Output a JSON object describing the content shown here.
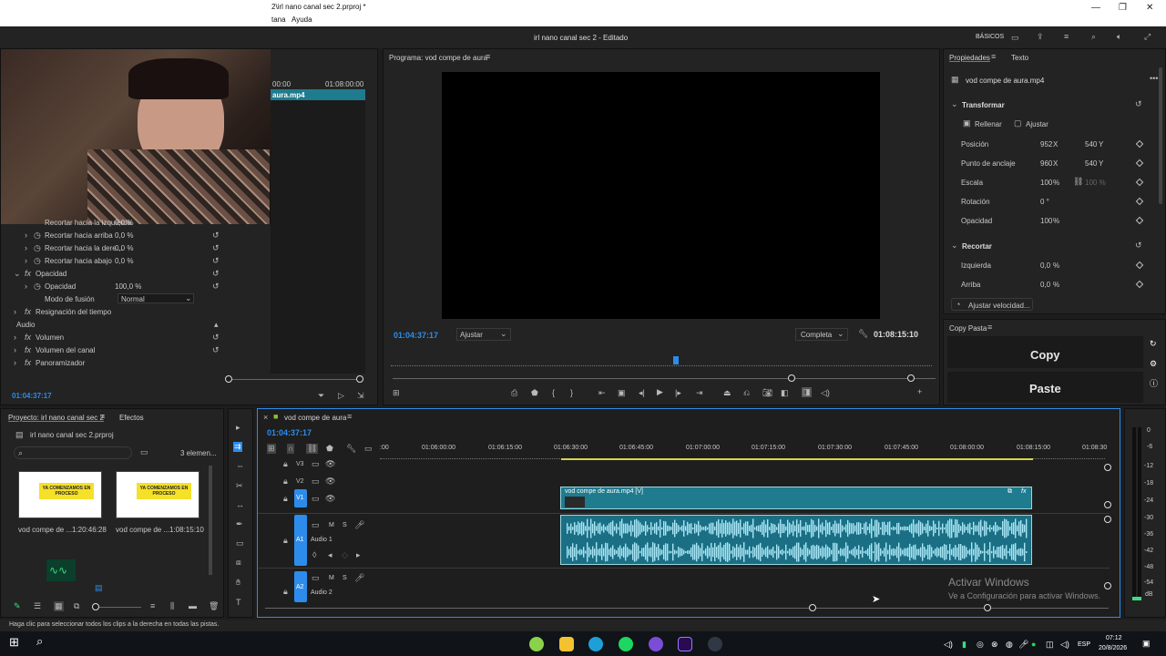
{
  "window": {
    "title": "2\\irl nano canal sec 2.prproj *",
    "menu": [
      "tana",
      "Ayuda"
    ]
  },
  "header": {
    "project_title": "irl nano canal sec 2 - Editado",
    "workspace": "BÁSICOS"
  },
  "source_panel": {
    "ruler": [
      "00:00",
      "01:08:00:00"
    ],
    "clip_name": "aura.mp4",
    "rows": [
      {
        "label": "Recortar hacia la izquierda",
        "value": "0,0 %"
      },
      {
        "label": "Recortar hacia arriba",
        "value": "0,0 %"
      },
      {
        "label": "Recortar hacia la dere...",
        "value": "0,0 %"
      },
      {
        "label": "Recortar hacia abajo",
        "value": "0,0 %"
      }
    ],
    "opacity_group": "Opacidad",
    "opacity_label": "Opacidad",
    "opacity_value": "100,0 %",
    "blend_label": "Modo de fusión",
    "blend_value": "Normal",
    "time_remap": "Resignación del tiempo",
    "audio_header": "Audio",
    "volume": "Volumen",
    "channel_volume": "Volumen del canal",
    "panner": "Panoramizador",
    "timecode": "01:04:37:17"
  },
  "program_monitor": {
    "tab": "Programa: vod compe de aura",
    "timecode": "01:04:37:17",
    "fit": "Ajustar",
    "quality": "Completa",
    "duration": "01:08:15:10"
  },
  "properties": {
    "tabs": [
      "Propiedades",
      "Texto"
    ],
    "clip": "vod compe de aura.mp4",
    "transform": "Transformar",
    "fill": "Rellenar",
    "fit": "Ajustar",
    "position_label": "Posición",
    "position_x": "952",
    "position_y": "540",
    "anchor_label": "Punto de anclaje",
    "anchor_x": "960",
    "anchor_y": "540",
    "scale_label": "Escala",
    "scale_value": "100",
    "scale_value2": "100 %",
    "rotation_label": "Rotación",
    "rotation_value": "0 °",
    "opacity_label": "Opacidad",
    "opacity_value": "100",
    "crop": "Recortar",
    "left_label": "Izquierda",
    "left_value": "0,0",
    "top_label": "Arriba",
    "top_value": "0,0",
    "speed_button": "Ajustar velocidad..."
  },
  "copy_paste": {
    "tab": "Copy Pasta",
    "copy": "Copy",
    "paste": "Paste"
  },
  "project_panel": {
    "tabs": [
      "Proyecto: irl nano canal sec 2",
      "Efectos"
    ],
    "file": "irl nano canal sec 2.prproj",
    "count": "3 elemen...",
    "items": [
      {
        "name": "vod compe de ...",
        "duration": "1:20:46:28",
        "thumb_text": "YA COMENZAMOS EN PROCESO"
      },
      {
        "name": "vod compe de ...",
        "duration": "1:08:15:10",
        "thumb_text": "YA COMENZAMOS EN PROCESO"
      }
    ]
  },
  "timeline": {
    "tab": "vod compe de aura",
    "timecode": "01:04:37:17",
    "ruler": [
      ":00",
      "01:06:00:00",
      "01:06:15:00",
      "01:06:30:00",
      "01:06:45:00",
      "01:07:00:00",
      "01:07:15:00",
      "01:07:30:00",
      "01:07:45:00",
      "01:08:00:00",
      "01:08:15:00",
      "01:08:30"
    ],
    "tracks": [
      "V3",
      "V2",
      "V1",
      "A1",
      "A2"
    ],
    "audio1_name": "Audio 1",
    "audio2_name": "Audio 2",
    "video_clip": "vod compe de aura.mp4 [V]",
    "mute": "M",
    "solo": "S",
    "fx": "fx"
  },
  "meter_labels": [
    "0",
    "-6",
    "-12",
    "-18",
    "-24",
    "-30",
    "-36",
    "-42",
    "-48",
    "-54",
    "dB"
  ],
  "status": "Haga clic para seleccionar todos los clips a la derecha en todas las pistas.",
  "watermark": {
    "title": "Activar Windows",
    "subtitle": "Ve a Configuración para activar Windows."
  },
  "taskbar": {
    "lang": "ESP",
    "time": "07:12",
    "date": "20/8/2026"
  }
}
